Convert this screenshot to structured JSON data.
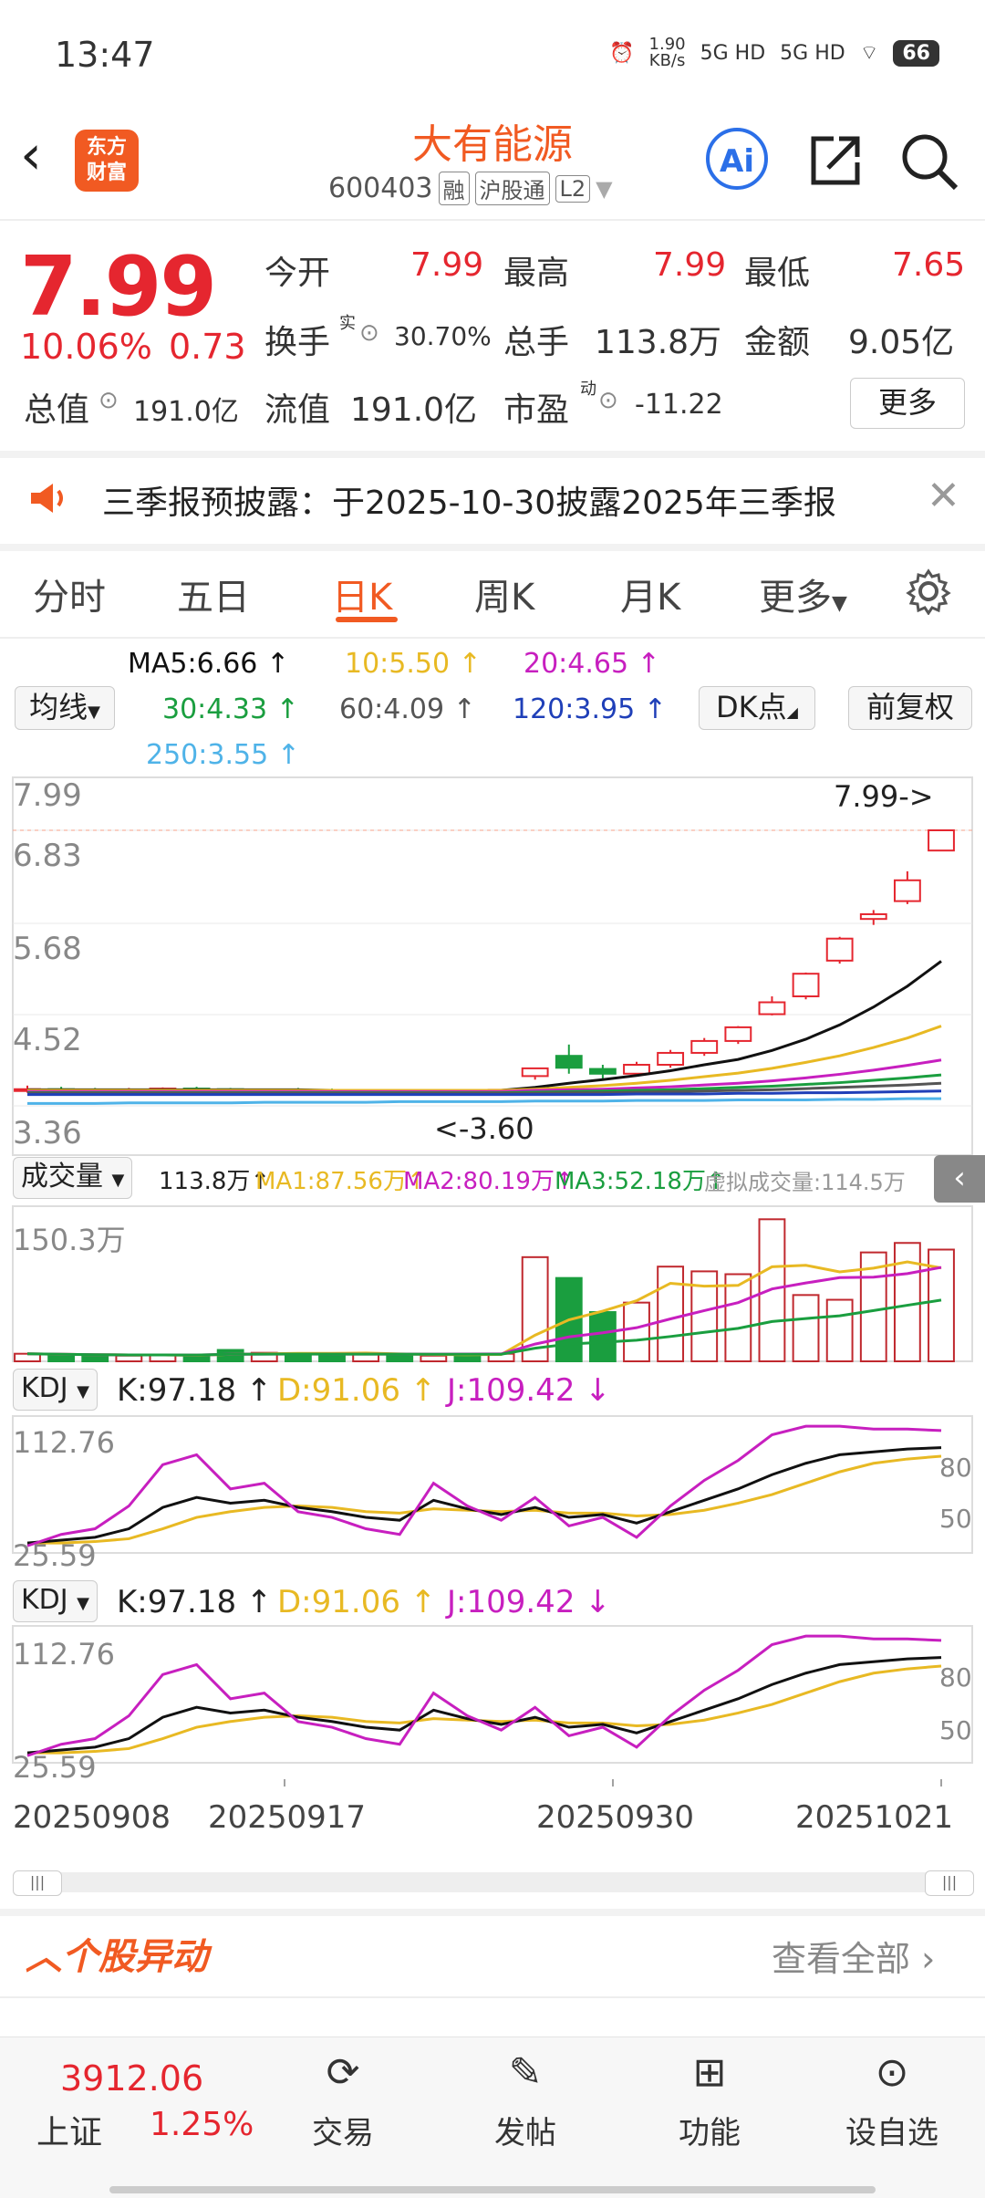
{
  "status_bar": {
    "time": "13:47",
    "net_speed_value": "1.90",
    "net_speed_unit": "KB/s",
    "sig1": "5G HD",
    "sig2": "5G HD",
    "battery": "66"
  },
  "header": {
    "back_icon": "chevron-left-icon",
    "brand_line1": "东方",
    "brand_line2": "财富",
    "name": "大有能源",
    "code": "600403",
    "tags": [
      "融",
      "沪股通",
      "L2"
    ],
    "ai_label": "Ai"
  },
  "quote": {
    "price": "7.99",
    "change_pct": "10.06%",
    "change": "0.73",
    "open_label": "今开",
    "open": "7.99",
    "high_label": "最高",
    "high": "7.99",
    "low_label": "最低",
    "low": "7.65",
    "turnover_label": "换手",
    "turnover_sup": "实",
    "turnover": "30.70%",
    "volume_label": "总手",
    "volume": "113.8万",
    "amount_label": "金额",
    "amount": "9.05亿",
    "total_mv_label": "总值",
    "total_mv": "191.0亿",
    "float_mv_label": "流值",
    "float_mv": "191.0亿",
    "pe_label": "市盈",
    "pe_sup": "动",
    "pe": "-11.22",
    "more_label": "更多"
  },
  "notice": {
    "text": "三季报预披露：于2025-10-30披露2025年三季报"
  },
  "tabs": [
    "分时",
    "五日",
    "日K",
    "周K",
    "月K",
    "更多"
  ],
  "active_tab": "日K",
  "ma_legend": {
    "ma5": "MA5:6.66",
    "ma10": "10:5.50",
    "ma20": "20:4.65",
    "ma30": "30:4.33",
    "ma60": "60:4.09",
    "ma120": "120:3.95",
    "ma250": "250:3.55",
    "dropdown": "均线",
    "dk_label": "DK点",
    "adjust_label": "前复权"
  },
  "price_axis": {
    "labels": [
      "7.99",
      "6.83",
      "5.68",
      "4.52",
      "3.36"
    ],
    "high_marker": "7.99->",
    "low_marker": "<-3.60"
  },
  "volume_legend": {
    "dropdown": "成交量",
    "vol": "113.8万",
    "ma1": "MA1:87.56万",
    "ma2": "MA2:80.19万",
    "ma3": "MA3:52.18万",
    "virtual": "虚拟成交量:114.5万",
    "axis_top": "150.3万"
  },
  "kdj": {
    "dropdown": "KDJ",
    "k": "K:97.18",
    "d": "D:91.06",
    "j": "J:109.42",
    "axis_top": "112.76",
    "axis_bottom": "25.59",
    "level80": "80",
    "level50": "50"
  },
  "date_axis": [
    "20250908",
    "20250917",
    "20250930",
    "20251021"
  ],
  "section": {
    "title": "个股异动",
    "view_all": "查看全部"
  },
  "bottom_nav": {
    "index_value": "3912.06",
    "index_name": "上证",
    "index_change": "1.25%",
    "items": [
      "交易",
      "发帖",
      "功能",
      "设自选"
    ]
  },
  "chart_data": {
    "type": "candlestick",
    "y_range": [
      3.36,
      7.99
    ],
    "candles": [
      {
        "o": 3.62,
        "h": 3.7,
        "l": 3.58,
        "c": 3.64
      },
      {
        "o": 3.64,
        "h": 3.68,
        "l": 3.6,
        "c": 3.63
      },
      {
        "o": 3.63,
        "h": 3.66,
        "l": 3.6,
        "c": 3.62
      },
      {
        "o": 3.62,
        "h": 3.66,
        "l": 3.6,
        "c": 3.63
      },
      {
        "o": 3.63,
        "h": 3.67,
        "l": 3.61,
        "c": 3.65
      },
      {
        "o": 3.65,
        "h": 3.68,
        "l": 3.62,
        "c": 3.64
      },
      {
        "o": 3.64,
        "h": 3.66,
        "l": 3.61,
        "c": 3.62
      },
      {
        "o": 3.62,
        "h": 3.65,
        "l": 3.6,
        "c": 3.63
      },
      {
        "o": 3.63,
        "h": 3.66,
        "l": 3.61,
        "c": 3.62
      },
      {
        "o": 3.62,
        "h": 3.65,
        "l": 3.6,
        "c": 3.61
      },
      {
        "o": 3.61,
        "h": 3.64,
        "l": 3.6,
        "c": 3.62
      },
      {
        "o": 3.62,
        "h": 3.64,
        "l": 3.6,
        "c": 3.61
      },
      {
        "o": 3.61,
        "h": 3.63,
        "l": 3.6,
        "c": 3.62
      },
      {
        "o": 3.62,
        "h": 3.64,
        "l": 3.6,
        "c": 3.61
      },
      {
        "o": 3.61,
        "h": 3.64,
        "l": 3.6,
        "c": 3.63
      },
      {
        "o": 3.86,
        "h": 3.99,
        "l": 3.8,
        "c": 3.99
      },
      {
        "o": 4.2,
        "h": 4.39,
        "l": 3.9,
        "c": 4.0
      },
      {
        "o": 3.98,
        "h": 4.05,
        "l": 3.8,
        "c": 3.9
      },
      {
        "o": 3.9,
        "h": 4.1,
        "l": 3.88,
        "c": 4.05
      },
      {
        "o": 4.05,
        "h": 4.3,
        "l": 4.0,
        "c": 4.25
      },
      {
        "o": 4.25,
        "h": 4.5,
        "l": 4.2,
        "c": 4.45
      },
      {
        "o": 4.45,
        "h": 4.7,
        "l": 4.4,
        "c": 4.68
      },
      {
        "o": 4.9,
        "h": 5.2,
        "l": 4.88,
        "c": 5.1
      },
      {
        "o": 5.2,
        "h": 5.6,
        "l": 5.15,
        "c": 5.58
      },
      {
        "o": 5.8,
        "h": 6.2,
        "l": 5.75,
        "c": 6.17
      },
      {
        "o": 6.5,
        "h": 6.65,
        "l": 6.4,
        "c": 6.58
      },
      {
        "o": 6.8,
        "h": 7.3,
        "l": 6.75,
        "c": 7.15
      },
      {
        "o": 7.65,
        "h": 7.99,
        "l": 7.65,
        "c": 7.99
      }
    ],
    "ma_series": [
      {
        "name": "MA5",
        "color": "#111111",
        "values": [
          3.63,
          3.63,
          3.63,
          3.63,
          3.63,
          3.63,
          3.63,
          3.63,
          3.63,
          3.62,
          3.62,
          3.62,
          3.62,
          3.62,
          3.62,
          3.67,
          3.74,
          3.8,
          3.87,
          3.95,
          4.05,
          4.14,
          4.29,
          4.48,
          4.72,
          5.02,
          5.37,
          5.79
        ]
      },
      {
        "name": "MA10",
        "color": "#e8b923",
        "values": [
          3.62,
          3.62,
          3.62,
          3.62,
          3.62,
          3.62,
          3.62,
          3.62,
          3.62,
          3.62,
          3.62,
          3.62,
          3.62,
          3.62,
          3.62,
          3.64,
          3.67,
          3.7,
          3.74,
          3.79,
          3.85,
          3.91,
          3.99,
          4.09,
          4.2,
          4.34,
          4.5,
          4.7
        ]
      },
      {
        "name": "MA20",
        "color": "#c71fbf",
        "values": [
          3.6,
          3.6,
          3.6,
          3.6,
          3.6,
          3.6,
          3.6,
          3.6,
          3.6,
          3.6,
          3.6,
          3.6,
          3.6,
          3.6,
          3.6,
          3.62,
          3.63,
          3.64,
          3.66,
          3.68,
          3.71,
          3.74,
          3.78,
          3.83,
          3.89,
          3.96,
          4.04,
          4.13
        ]
      },
      {
        "name": "MA30",
        "color": "#1a9e3f",
        "values": [
          3.58,
          3.58,
          3.58,
          3.58,
          3.58,
          3.58,
          3.58,
          3.58,
          3.58,
          3.58,
          3.58,
          3.58,
          3.58,
          3.58,
          3.58,
          3.59,
          3.6,
          3.61,
          3.62,
          3.63,
          3.65,
          3.67,
          3.69,
          3.72,
          3.75,
          3.79,
          3.83,
          3.88
        ]
      },
      {
        "name": "MA60",
        "color": "#555555",
        "values": [
          3.57,
          3.57,
          3.57,
          3.57,
          3.57,
          3.57,
          3.57,
          3.57,
          3.57,
          3.57,
          3.57,
          3.57,
          3.57,
          3.57,
          3.57,
          3.57,
          3.58,
          3.58,
          3.59,
          3.6,
          3.61,
          3.62,
          3.63,
          3.65,
          3.67,
          3.69,
          3.71,
          3.74
        ]
      },
      {
        "name": "MA120",
        "color": "#1f3fb8",
        "values": [
          3.55,
          3.55,
          3.55,
          3.55,
          3.55,
          3.55,
          3.55,
          3.55,
          3.55,
          3.55,
          3.55,
          3.55,
          3.55,
          3.55,
          3.55,
          3.55,
          3.55,
          3.55,
          3.56,
          3.56,
          3.56,
          3.57,
          3.57,
          3.58,
          3.58,
          3.59,
          3.6,
          3.61
        ]
      },
      {
        "name": "MA250",
        "color": "#4fb3e8",
        "values": [
          3.4,
          3.4,
          3.4,
          3.41,
          3.41,
          3.41,
          3.41,
          3.42,
          3.42,
          3.42,
          3.42,
          3.43,
          3.43,
          3.43,
          3.43,
          3.44,
          3.44,
          3.44,
          3.45,
          3.45,
          3.45,
          3.46,
          3.46,
          3.46,
          3.47,
          3.47,
          3.48,
          3.48
        ]
      }
    ],
    "volume": [
      8,
      7,
      6,
      6,
      7,
      6,
      12,
      9,
      8,
      7,
      8,
      7,
      6,
      7,
      8,
      110,
      88,
      52,
      62,
      100,
      95,
      92,
      150,
      70,
      65,
      115,
      125,
      118
    ],
    "volume_max": 150.3,
    "kdj_k": [
      30,
      32,
      34,
      40,
      55,
      62,
      58,
      60,
      55,
      52,
      48,
      46,
      60,
      54,
      50,
      55,
      48,
      50,
      44,
      52,
      60,
      68,
      78,
      86,
      92,
      94,
      96,
      97
    ],
    "kdj_d": [
      30,
      30,
      31,
      33,
      40,
      48,
      52,
      55,
      56,
      55,
      52,
      51,
      54,
      53,
      52,
      53,
      51,
      51,
      49,
      50,
      53,
      58,
      64,
      72,
      80,
      86,
      89,
      91
    ],
    "kdj_j": [
      28,
      36,
      40,
      56,
      85,
      92,
      68,
      72,
      52,
      48,
      40,
      36,
      72,
      56,
      46,
      62,
      42,
      48,
      34,
      56,
      74,
      88,
      106,
      112,
      112,
      110,
      110,
      109
    ],
    "kdj_range": [
      25.59,
      112.76
    ]
  }
}
